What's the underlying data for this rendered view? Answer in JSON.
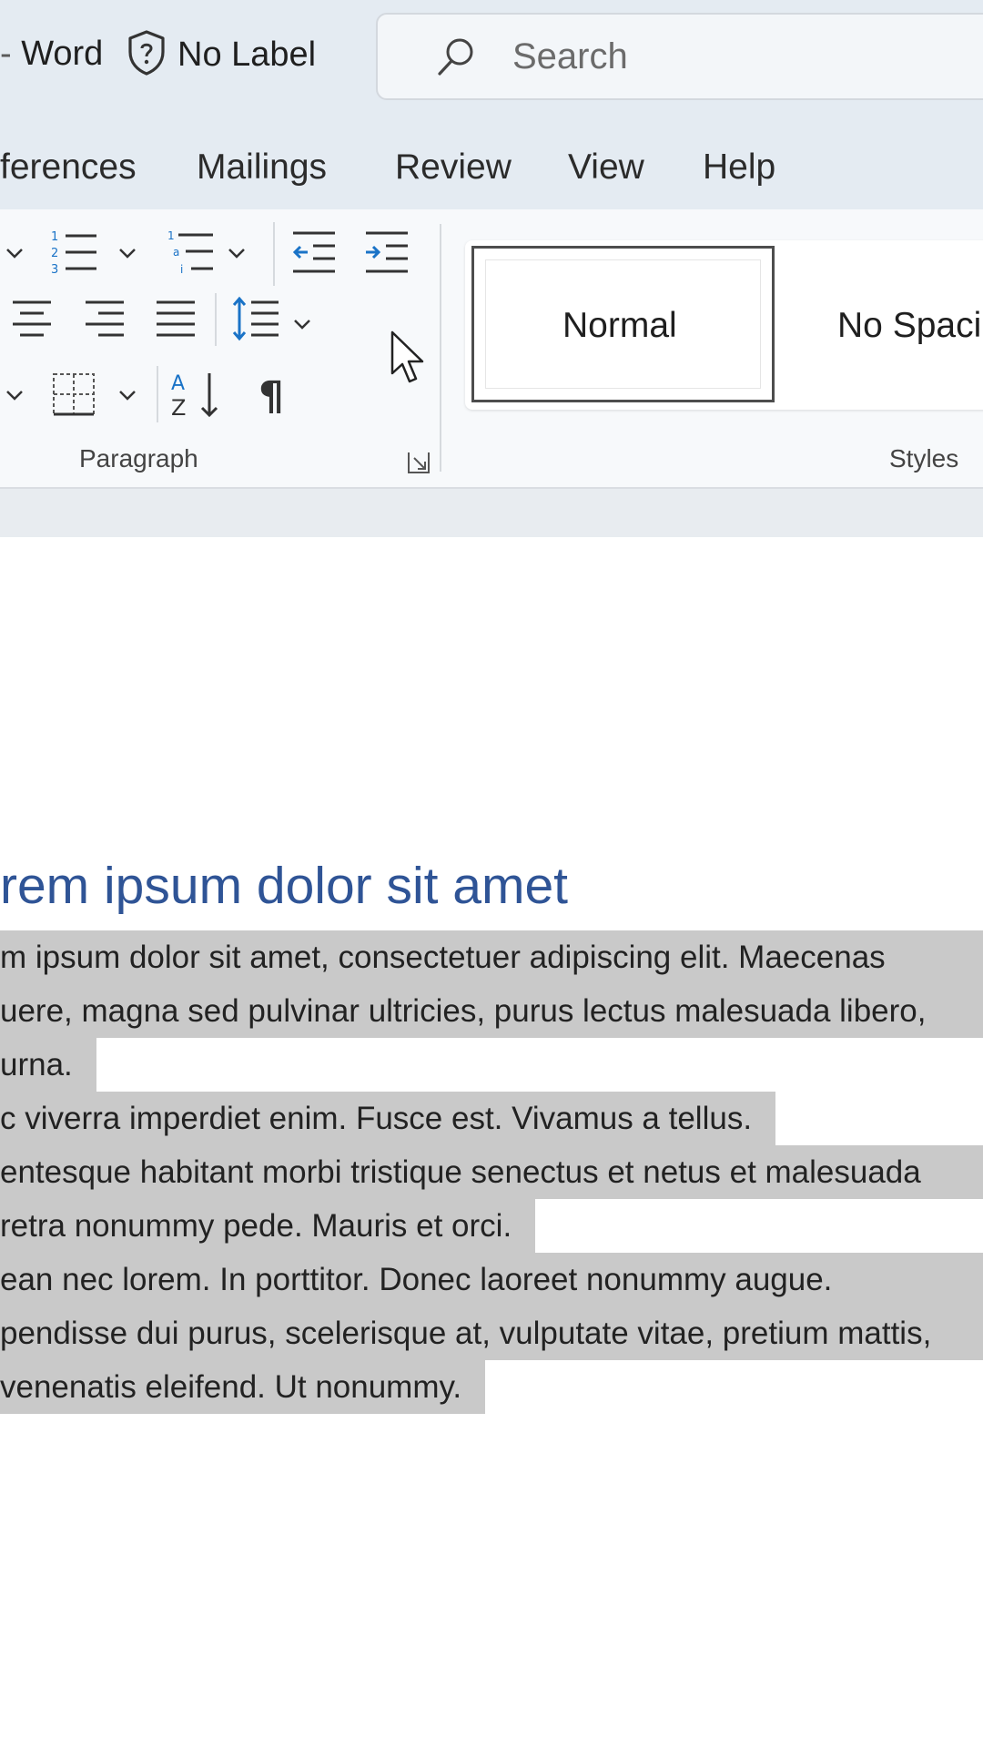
{
  "titlebar": {
    "app_name": "Word",
    "sensitivity_label": "No Label",
    "search_placeholder": "Search"
  },
  "tabs": [
    "ferences",
    "Mailings",
    "Review",
    "View",
    "Help"
  ],
  "ribbon": {
    "paragraph_group_label": "Paragraph",
    "styles_group_label": "Styles",
    "styles": [
      "Normal",
      "No Spacin"
    ],
    "icons": {
      "bullets": "bullets-dropdown-icon",
      "numbering": "numbering-icon",
      "multilevel": "multilevel-list-icon",
      "decrease_indent": "decrease-indent-icon",
      "increase_indent": "increase-indent-icon",
      "align_center": "align-center-icon",
      "align_right": "align-right-icon",
      "justify": "justify-icon",
      "line_spacing": "line-spacing-icon",
      "borders": "borders-icon",
      "sort": "sort-icon",
      "show_marks": "pilcrow-icon",
      "dialog_launcher": "dialog-launcher-icon"
    }
  },
  "document": {
    "heading": "rem ipsum dolor sit amet",
    "lines": [
      "m ipsum dolor sit amet, consectetuer adipiscing elit. Maecenas",
      "uere, magna sed pulvinar ultricies, purus lectus malesuada libero,",
      " urna.",
      "c viverra imperdiet enim. Fusce est. Vivamus a tellus.",
      "entesque habitant morbi tristique senectus et netus et malesuada",
      "retra nonummy pede. Mauris et orci.",
      "ean nec lorem. In porttitor. Donec laoreet nonummy augue.",
      "pendisse dui purus, scelerisque at, vulputate vitae, pretium mattis,",
      " venenatis eleifend. Ut nonummy."
    ]
  },
  "colors": {
    "titlebar_bg": "#e4ebf2",
    "heading": "#2f5496",
    "selection": "#c9c9c9",
    "accent_blue": "#1a73c7"
  }
}
